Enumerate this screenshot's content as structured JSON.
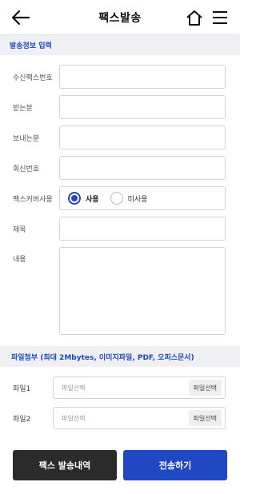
{
  "header": {
    "title": "팩스발송",
    "back_icon": "back-arrow-icon",
    "home_icon": "home-icon",
    "menu_icon": "hamburger-menu-icon"
  },
  "section": {
    "title": "발송정보 입력"
  },
  "form": {
    "fax_number_label": "수신팩스번호",
    "recipient_label": "받는분",
    "sender_label": "보내는분",
    "reply_number_label": "회신번호",
    "cover_label": "팩스커버사용",
    "cover_options": [
      {
        "label": "사용",
        "checked": true
      },
      {
        "label": "미사용",
        "checked": false
      }
    ],
    "subject_label": "제목",
    "content_label": "내용"
  },
  "attach": {
    "title": "파일첨부 (최대 2Mbytes, 이미지파일, PDF, 오피스문서)",
    "files": [
      {
        "label": "파일1",
        "placeholder": "파일선택",
        "button": "파일선택"
      },
      {
        "label": "파일2",
        "placeholder": "파일선택",
        "button": "파일선택"
      }
    ]
  },
  "actions": {
    "history_label": "팩스 발송내역",
    "send_label": "전송하기"
  },
  "colors": {
    "accent": "#1f48c2",
    "dark_button": "#2b2b2b",
    "section_bg": "#eef0f4"
  }
}
